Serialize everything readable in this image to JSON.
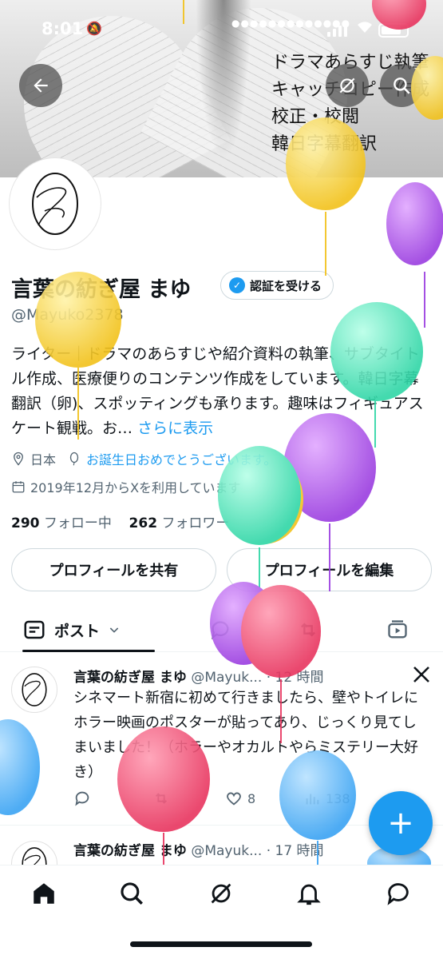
{
  "status_bar": {
    "time": "8:01"
  },
  "banner": {
    "lines": [
      "ドラマあらすじ執筆",
      "キャッチコピー作成",
      "校正・校閲",
      "韓日字幕翻訳"
    ]
  },
  "profile": {
    "name": "言葉の紡ぎ屋 まゆ",
    "verify_label": "認証を受ける",
    "handle": "@Mayuko2378",
    "bio": "ライター｜ドラマのあらすじや紹介資料の執筆、サブタイトル作成、医療便りのコンテンツ作成をしています。韓日字幕翻訳（卵)、スポッティングも承ります。趣味はフィギュアスケート観戦。お…",
    "bio_more": "さらに表示",
    "location": "日本",
    "birthday_link": "お誕生日おめでとうございます。",
    "joined": "2019年12月からXを利用しています",
    "following_count": "290",
    "following_label": "フォロー中",
    "followers_count": "262",
    "followers_label": "フォロワー"
  },
  "buttons": {
    "share_profile": "プロフィールを共有",
    "edit_profile": "プロフィールを編集"
  },
  "tabs": {
    "posts_label": "ポスト"
  },
  "posts": [
    {
      "author": "言葉の紡ぎ屋 まゆ",
      "handle_time": "@Mayuk... · 12 時間",
      "text": "シネマート新宿に初めて行きましたら、壁やトイレにホラー映画のポスターが貼ってあり、じっくり見てしまいました！（ホラーやオカルトやらミステリー大好き）",
      "likes": "8",
      "views": "138"
    },
    {
      "author": "言葉の紡ぎ屋 まゆ",
      "handle_time": "@Mayuk... · 17 時間"
    }
  ],
  "fab_label": "+",
  "icons": [
    "back-arrow-icon",
    "grok-icon",
    "search-icon",
    "bell-icon",
    "verified-badge-icon",
    "location-icon",
    "balloon-icon",
    "calendar-icon",
    "chevron-down-icon",
    "reply-icon",
    "retweet-icon",
    "like-icon",
    "views-icon",
    "video-icon",
    "home-icon",
    "messages-icon",
    "x-logo-icon"
  ],
  "colors": {
    "accent": "#1d9bf0",
    "text": "#0f1419",
    "muted": "#536471"
  }
}
